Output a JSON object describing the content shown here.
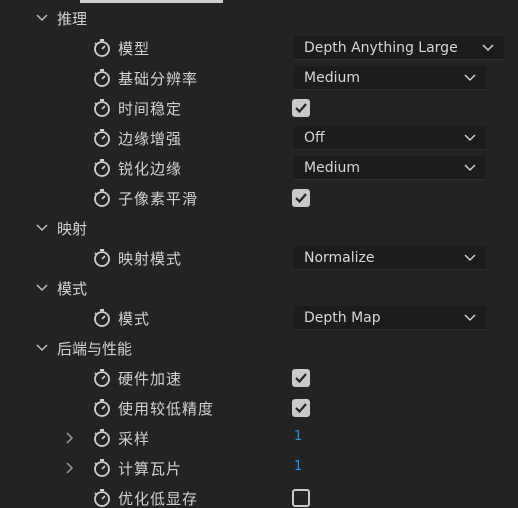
{
  "sections": {
    "inference": {
      "label": "推理",
      "icon": "chevron-down-icon"
    },
    "mapping": {
      "label": "映射",
      "icon": "chevron-down-icon"
    },
    "mode": {
      "label": "模式",
      "icon": "chevron-down-icon"
    },
    "backend": {
      "label": "后端与性能",
      "icon": "chevron-down-icon"
    }
  },
  "props": {
    "model": {
      "label": "模型",
      "value": "Depth Anything Large"
    },
    "base_resolution": {
      "label": "基础分辨率",
      "value": "Medium"
    },
    "temporal_stable": {
      "label": "时间稳定",
      "checked": true
    },
    "edge_enhance": {
      "label": "边缘增强",
      "value": "Off"
    },
    "sharpen_edges": {
      "label": "锐化边缘",
      "value": "Medium"
    },
    "subpixel_smooth": {
      "label": "子像素平滑",
      "checked": true
    },
    "mapping_mode": {
      "label": "映射模式",
      "value": "Normalize"
    },
    "mode": {
      "label": "模式",
      "value": "Depth Map"
    },
    "hw_accel": {
      "label": "硬件加速",
      "checked": true
    },
    "lower_precision": {
      "label": "使用较低精度",
      "checked": true
    },
    "sampling": {
      "label": "采样",
      "value": "1"
    },
    "compute_tiles": {
      "label": "计算瓦片",
      "value": "1"
    },
    "optimize_low_vram": {
      "label": "优化低显存",
      "checked": false
    }
  },
  "colors": {
    "background": "#232323",
    "dropdown_bg": "#1c1c1c",
    "text": "#d2d2d2",
    "number_accent": "#2d8ceb",
    "checkbox": "#c9c9c9"
  },
  "icons": {
    "stopwatch": "stopwatch-icon",
    "caret": "chevron-down-icon",
    "expander": "chevron-right-icon",
    "check": "checkmark-icon"
  }
}
